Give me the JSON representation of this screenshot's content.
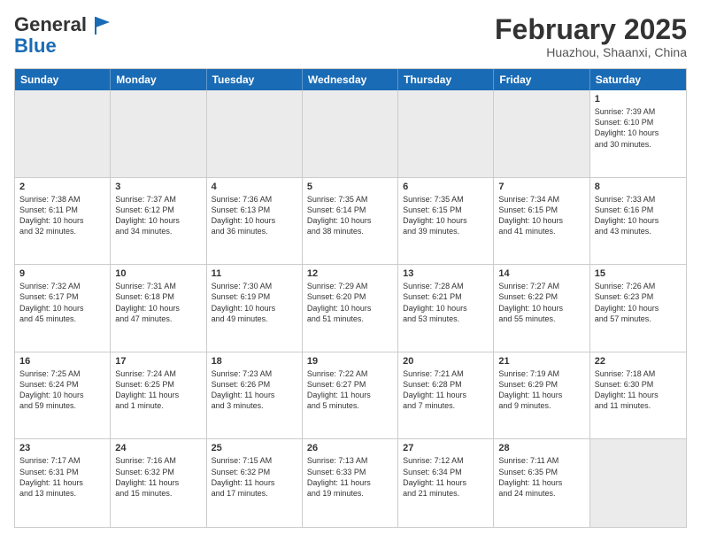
{
  "header": {
    "logo_line1": "General",
    "logo_line2": "Blue",
    "month_title": "February 2025",
    "location": "Huazhou, Shaanxi, China"
  },
  "days_of_week": [
    "Sunday",
    "Monday",
    "Tuesday",
    "Wednesday",
    "Thursday",
    "Friday",
    "Saturday"
  ],
  "weeks": [
    [
      {
        "day": "",
        "info": "",
        "shaded": true
      },
      {
        "day": "",
        "info": "",
        "shaded": true
      },
      {
        "day": "",
        "info": "",
        "shaded": true
      },
      {
        "day": "",
        "info": "",
        "shaded": true
      },
      {
        "day": "",
        "info": "",
        "shaded": true
      },
      {
        "day": "",
        "info": "",
        "shaded": true
      },
      {
        "day": "1",
        "info": "Sunrise: 7:39 AM\nSunset: 6:10 PM\nDaylight: 10 hours\nand 30 minutes.",
        "shaded": false
      }
    ],
    [
      {
        "day": "2",
        "info": "Sunrise: 7:38 AM\nSunset: 6:11 PM\nDaylight: 10 hours\nand 32 minutes.",
        "shaded": false
      },
      {
        "day": "3",
        "info": "Sunrise: 7:37 AM\nSunset: 6:12 PM\nDaylight: 10 hours\nand 34 minutes.",
        "shaded": false
      },
      {
        "day": "4",
        "info": "Sunrise: 7:36 AM\nSunset: 6:13 PM\nDaylight: 10 hours\nand 36 minutes.",
        "shaded": false
      },
      {
        "day": "5",
        "info": "Sunrise: 7:35 AM\nSunset: 6:14 PM\nDaylight: 10 hours\nand 38 minutes.",
        "shaded": false
      },
      {
        "day": "6",
        "info": "Sunrise: 7:35 AM\nSunset: 6:15 PM\nDaylight: 10 hours\nand 39 minutes.",
        "shaded": false
      },
      {
        "day": "7",
        "info": "Sunrise: 7:34 AM\nSunset: 6:15 PM\nDaylight: 10 hours\nand 41 minutes.",
        "shaded": false
      },
      {
        "day": "8",
        "info": "Sunrise: 7:33 AM\nSunset: 6:16 PM\nDaylight: 10 hours\nand 43 minutes.",
        "shaded": false
      }
    ],
    [
      {
        "day": "9",
        "info": "Sunrise: 7:32 AM\nSunset: 6:17 PM\nDaylight: 10 hours\nand 45 minutes.",
        "shaded": false
      },
      {
        "day": "10",
        "info": "Sunrise: 7:31 AM\nSunset: 6:18 PM\nDaylight: 10 hours\nand 47 minutes.",
        "shaded": false
      },
      {
        "day": "11",
        "info": "Sunrise: 7:30 AM\nSunset: 6:19 PM\nDaylight: 10 hours\nand 49 minutes.",
        "shaded": false
      },
      {
        "day": "12",
        "info": "Sunrise: 7:29 AM\nSunset: 6:20 PM\nDaylight: 10 hours\nand 51 minutes.",
        "shaded": false
      },
      {
        "day": "13",
        "info": "Sunrise: 7:28 AM\nSunset: 6:21 PM\nDaylight: 10 hours\nand 53 minutes.",
        "shaded": false
      },
      {
        "day": "14",
        "info": "Sunrise: 7:27 AM\nSunset: 6:22 PM\nDaylight: 10 hours\nand 55 minutes.",
        "shaded": false
      },
      {
        "day": "15",
        "info": "Sunrise: 7:26 AM\nSunset: 6:23 PM\nDaylight: 10 hours\nand 57 minutes.",
        "shaded": false
      }
    ],
    [
      {
        "day": "16",
        "info": "Sunrise: 7:25 AM\nSunset: 6:24 PM\nDaylight: 10 hours\nand 59 minutes.",
        "shaded": false
      },
      {
        "day": "17",
        "info": "Sunrise: 7:24 AM\nSunset: 6:25 PM\nDaylight: 11 hours\nand 1 minute.",
        "shaded": false
      },
      {
        "day": "18",
        "info": "Sunrise: 7:23 AM\nSunset: 6:26 PM\nDaylight: 11 hours\nand 3 minutes.",
        "shaded": false
      },
      {
        "day": "19",
        "info": "Sunrise: 7:22 AM\nSunset: 6:27 PM\nDaylight: 11 hours\nand 5 minutes.",
        "shaded": false
      },
      {
        "day": "20",
        "info": "Sunrise: 7:21 AM\nSunset: 6:28 PM\nDaylight: 11 hours\nand 7 minutes.",
        "shaded": false
      },
      {
        "day": "21",
        "info": "Sunrise: 7:19 AM\nSunset: 6:29 PM\nDaylight: 11 hours\nand 9 minutes.",
        "shaded": false
      },
      {
        "day": "22",
        "info": "Sunrise: 7:18 AM\nSunset: 6:30 PM\nDaylight: 11 hours\nand 11 minutes.",
        "shaded": false
      }
    ],
    [
      {
        "day": "23",
        "info": "Sunrise: 7:17 AM\nSunset: 6:31 PM\nDaylight: 11 hours\nand 13 minutes.",
        "shaded": false
      },
      {
        "day": "24",
        "info": "Sunrise: 7:16 AM\nSunset: 6:32 PM\nDaylight: 11 hours\nand 15 minutes.",
        "shaded": false
      },
      {
        "day": "25",
        "info": "Sunrise: 7:15 AM\nSunset: 6:32 PM\nDaylight: 11 hours\nand 17 minutes.",
        "shaded": false
      },
      {
        "day": "26",
        "info": "Sunrise: 7:13 AM\nSunset: 6:33 PM\nDaylight: 11 hours\nand 19 minutes.",
        "shaded": false
      },
      {
        "day": "27",
        "info": "Sunrise: 7:12 AM\nSunset: 6:34 PM\nDaylight: 11 hours\nand 21 minutes.",
        "shaded": false
      },
      {
        "day": "28",
        "info": "Sunrise: 7:11 AM\nSunset: 6:35 PM\nDaylight: 11 hours\nand 24 minutes.",
        "shaded": false
      },
      {
        "day": "",
        "info": "",
        "shaded": true
      }
    ]
  ]
}
